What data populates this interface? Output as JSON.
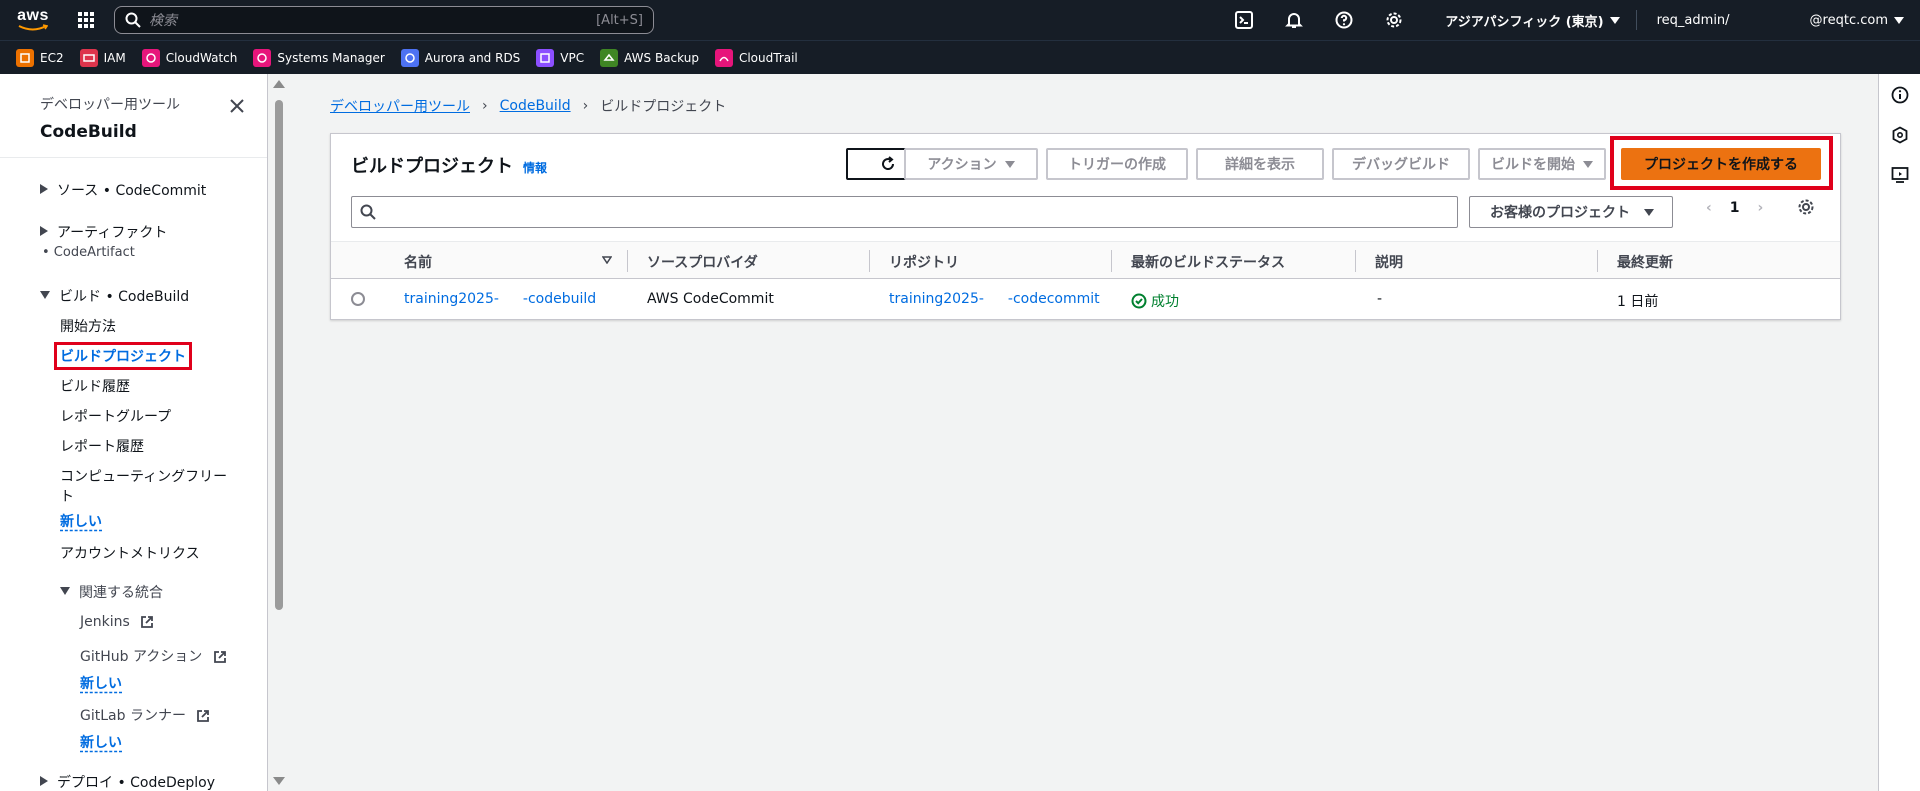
{
  "topnav": {
    "logo_text": "aws",
    "search_placeholder": "検索",
    "search_shortcut": "[Alt+S]",
    "region": "アジアパシフィック (東京)",
    "account_left": "req_admin/",
    "account_right": "@reqtc.com"
  },
  "favorites": [
    {
      "label": "EC2",
      "color": "#ed7100"
    },
    {
      "label": "IAM",
      "color": "#dd344c"
    },
    {
      "label": "CloudWatch",
      "color": "#e7157b"
    },
    {
      "label": "Systems Manager",
      "color": "#e7157b"
    },
    {
      "label": "Aurora and RDS",
      "color": "#4d72f3"
    },
    {
      "label": "VPC",
      "color": "#8c4fff"
    },
    {
      "label": "AWS Backup",
      "color": "#3f8624"
    },
    {
      "label": "CloudTrail",
      "color": "#e7157b"
    }
  ],
  "sidenav": {
    "subtitle": "デベロッパー用ツール",
    "title": "CodeBuild",
    "source": "ソース • CodeCommit",
    "artifacts": "アーティファクト",
    "artifacts_sub": "• CodeArtifact",
    "build": "ビルド • CodeBuild",
    "getting_started": "開始方法",
    "build_projects": "ビルドプロジェクト",
    "build_history": "ビルド履歴",
    "report_groups": "レポートグループ",
    "report_history": "レポート履歴",
    "compute_fleet": "コンピューティングフリー",
    "compute_fleet_2": "ト",
    "new_label": "新しい",
    "account_metrics": "アカウントメトリクス",
    "related": "関連する統合",
    "jenkins": "Jenkins",
    "github_actions": "GitHub アクション",
    "gitlab_runner": "GitLab ランナー",
    "deploy": "デプロイ • CodeDeploy"
  },
  "breadcrumb": {
    "items": [
      "デベロッパー用ツール",
      "CodeBuild"
    ],
    "current": "ビルドプロジェクト"
  },
  "panel": {
    "title": "ビルドプロジェクト",
    "info": "情報",
    "actions": "アクション",
    "create_trigger": "トリガーの作成",
    "view_details": "詳細を表示",
    "debug_build": "デバッグビルド",
    "start_build": "ビルドを開始",
    "create_project": "プロジェクトを作成する",
    "filter_select": "お客様のプロジェクト",
    "page": "1"
  },
  "table": {
    "columns": [
      "名前",
      "ソースプロバイダ",
      "リポジトリ",
      "最新のビルドステータス",
      "説明",
      "最終更新"
    ],
    "rows": [
      {
        "name_a": "training2025-",
        "name_b": "-codebuild",
        "provider": "AWS CodeCommit",
        "repo_a": "training2025-",
        "repo_b": "-codecommit",
        "status": "成功",
        "description": "-",
        "updated": "1 日前"
      }
    ]
  },
  "colors": {
    "accent": "#ec7211",
    "link": "#006ce0",
    "highlight": "#e0001b",
    "success": "#00802f"
  }
}
